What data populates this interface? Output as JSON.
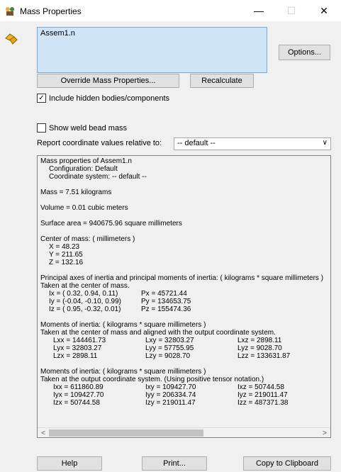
{
  "window": {
    "title": "Mass Properties",
    "minimize": "—",
    "maximize": "☐",
    "close": "✕"
  },
  "selection": {
    "items": [
      "Assem1.n"
    ]
  },
  "buttons": {
    "options": "Options...",
    "override": "Override Mass Properties...",
    "recalculate": "Recalculate",
    "help": "Help",
    "print": "Print...",
    "copy": "Copy to Clipboard"
  },
  "checkboxes": {
    "include_hidden": {
      "label": "Include hidden bodies/components",
      "checked": true
    },
    "weld_bead": {
      "label": "Show weld bead mass",
      "checked": false
    }
  },
  "report": {
    "label": "Report coordinate values relative to:",
    "selected": "-- default --"
  },
  "results": {
    "header": "Mass properties of Assem1.n",
    "configuration": "Configuration: Default",
    "coord_system": "Coordinate system: -- default --",
    "mass": "Mass = 7.51 kilograms",
    "volume": "Volume = 0.01 cubic meters",
    "surface_area": "Surface area = 940675.96  square millimeters",
    "com_title": "Center of mass: ( millimeters )",
    "com_x": "X = 48.23",
    "com_y": "Y = 211.65",
    "com_z": "Z = 132.16",
    "principal_title": "Principal axes of inertia and principal moments of inertia: ( kilograms *  square millimeters )",
    "principal_sub": "Taken at the center of mass.",
    "ix": "Ix = ( 0.32,  0.94,  0.11)",
    "iy": "Iy = (-0.04, -0.10,  0.99)",
    "iz": "Iz = ( 0.95, -0.32,  0.01)",
    "px": "Px = 45721.44",
    "py": "Py = 134653.75",
    "pz": "Pz = 155474.36",
    "moi1_title": "Moments of inertia: ( kilograms *  square millimeters )",
    "moi1_sub": "Taken at the center of mass and aligned with the output coordinate system.",
    "lxx": "Lxx = 144461.73",
    "lxy": "Lxy = 32803.27",
    "lxz": "Lxz = 2898.11",
    "lyx": "Lyx = 32803.27",
    "lyy": "Lyy = 57755.95",
    "lyz": "Lyz = 9028.70",
    "lzx": "Lzx = 2898.11",
    "lzy": "Lzy = 9028.70",
    "lzz": "Lzz = 133631.87",
    "moi2_title": "Moments of inertia: ( kilograms *  square millimeters )",
    "moi2_sub": "Taken at the output coordinate system. (Using positive tensor notation.)",
    "ixx": "Ixx = 611860.89",
    "ixy": "Ixy = 109427.70",
    "ixz": "Ixz = 50744.58",
    "iyx": "Iyx = 109427.70",
    "iyy": "Iyy = 206334.74",
    "iyz": "Iyz = 219011.47",
    "izx": "Izx = 50744.58",
    "izy": "Izy = 219011.47",
    "izz": "Izz = 487371.38"
  },
  "icons": {
    "app": "mass-properties-icon",
    "side": "assembly-icon",
    "check": "✓",
    "chevron": "∨",
    "scroll_left": "<",
    "scroll_right": ">"
  },
  "colors": {
    "selection_bg": "#cfe4f7",
    "dialog_bg": "#f0f0f0"
  }
}
